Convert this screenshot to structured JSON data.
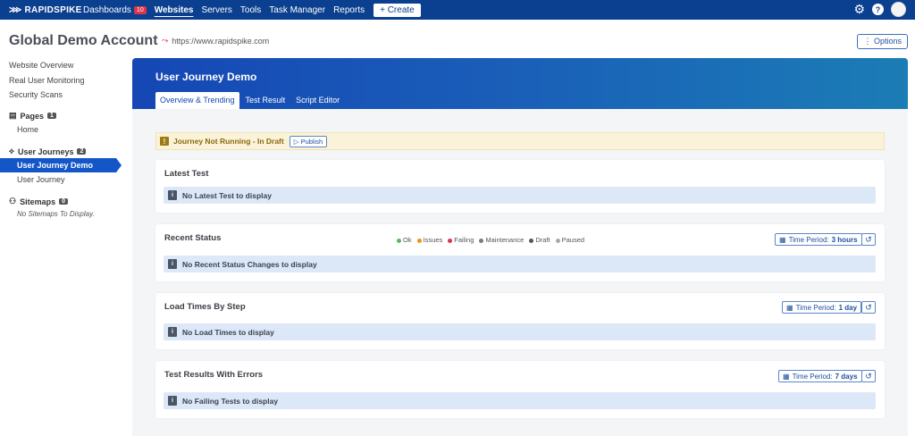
{
  "nav": {
    "logo": "RAPIDSPIKE",
    "items": [
      {
        "label": "Dashboards",
        "badge": "10"
      },
      {
        "label": "Websites"
      },
      {
        "label": "Servers"
      },
      {
        "label": "Tools"
      },
      {
        "label": "Task Manager"
      },
      {
        "label": "Reports"
      }
    ],
    "create_label": "+ Create",
    "help": "?"
  },
  "header": {
    "account_title": "Global Demo Account",
    "url": "https://www.rapidspike.com",
    "options_label": "⋮ Options"
  },
  "sidebar": {
    "links": [
      "Website Overview",
      "Real User Monitoring",
      "Security Scans"
    ],
    "pages": {
      "label": "Pages",
      "count": "1",
      "items": [
        "Home"
      ]
    },
    "journeys": {
      "label": "User Journeys",
      "count": "2",
      "items": [
        "User Journey Demo",
        "User Journey"
      ]
    },
    "sitemaps": {
      "label": "Sitemaps",
      "count": "0",
      "empty": "No Sitemaps To Display."
    }
  },
  "main": {
    "title": "User Journey Demo",
    "tabs": [
      "Overview & Trending",
      "Test Result",
      "Script Editor"
    ],
    "notice": {
      "text": "Journey Not Running - In Draft",
      "publish_label": "▷ Publish",
      "icon": "!"
    },
    "latest_test": {
      "title": "Latest Test",
      "empty": "No Latest Test to display"
    },
    "recent_status": {
      "title": "Recent Status",
      "legend": [
        {
          "label": "Ok",
          "color": "#5cb85c"
        },
        {
          "label": "Issues",
          "color": "#f0901a"
        },
        {
          "label": "Failing",
          "color": "#d9364b"
        },
        {
          "label": "Maintenance",
          "color": "#7a7a7a"
        },
        {
          "label": "Draft",
          "color": "#555555"
        },
        {
          "label": "Paused",
          "color": "#aaaaaa"
        }
      ],
      "time_label": "Time Period:",
      "time_value": "3 hours",
      "empty": "No Recent Status Changes to display"
    },
    "load_times": {
      "title": "Load Times By Step",
      "time_label": "Time Period:",
      "time_value": "1 day",
      "empty": "No Load Times to display"
    },
    "errors": {
      "title": "Test Results With Errors",
      "time_label": "Time Period:",
      "time_value": "7 days",
      "empty": "No Failing Tests to display"
    },
    "info_icon": "i"
  }
}
